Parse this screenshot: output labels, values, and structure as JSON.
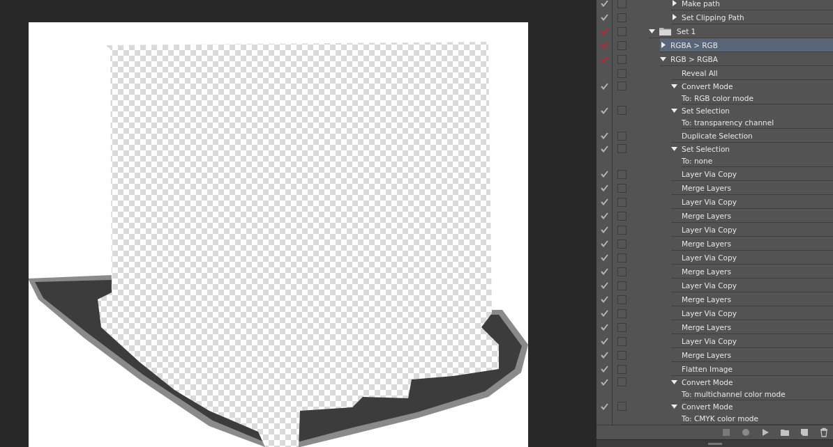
{
  "actions_panel": {
    "items": [
      {
        "kind": "command",
        "label": "Make path",
        "checked": true,
        "expanded": false,
        "selected": false
      },
      {
        "kind": "command",
        "label": "Set Clipping Path",
        "checked": true,
        "expanded": false,
        "selected": false
      },
      {
        "kind": "set",
        "label": "Set 1",
        "checked": true,
        "partial": true,
        "expanded": true,
        "selected": false,
        "children": [
          {
            "kind": "action",
            "label": "RGBA > RGB",
            "checked": true,
            "partial": true,
            "expanded": false,
            "selected": true
          },
          {
            "kind": "action",
            "label": "RGB > RGBA",
            "checked": true,
            "partial": true,
            "expanded": true,
            "selected": false,
            "children": [
              {
                "kind": "command",
                "label": "Reveal All",
                "checked": false,
                "partial": false,
                "selected": false
              },
              {
                "kind": "command",
                "label": "Convert Mode",
                "checked": true,
                "partial": false,
                "expanded": true,
                "selected": false,
                "children": [
                  {
                    "kind": "detail",
                    "label": "To: RGB color mode"
                  }
                ]
              },
              {
                "kind": "command",
                "label": "Set Selection",
                "checked": true,
                "partial": false,
                "expanded": true,
                "selected": false,
                "children": [
                  {
                    "kind": "detail",
                    "label": "To: transparency channel"
                  }
                ]
              },
              {
                "kind": "command",
                "label": "Duplicate Selection",
                "checked": true,
                "partial": false,
                "selected": false
              },
              {
                "kind": "command",
                "label": "Set Selection",
                "checked": true,
                "partial": false,
                "expanded": true,
                "selected": false,
                "children": [
                  {
                    "kind": "detail",
                    "label": "To: none"
                  }
                ]
              },
              {
                "kind": "command",
                "label": "Layer Via Copy",
                "checked": true,
                "partial": false,
                "selected": false
              },
              {
                "kind": "command",
                "label": "Merge Layers",
                "checked": true,
                "partial": false,
                "selected": false
              },
              {
                "kind": "command",
                "label": "Layer Via Copy",
                "checked": true,
                "partial": false,
                "selected": false
              },
              {
                "kind": "command",
                "label": "Merge Layers",
                "checked": true,
                "partial": false,
                "selected": false
              },
              {
                "kind": "command",
                "label": "Layer Via Copy",
                "checked": true,
                "partial": false,
                "selected": false
              },
              {
                "kind": "command",
                "label": "Merge Layers",
                "checked": true,
                "partial": false,
                "selected": false
              },
              {
                "kind": "command",
                "label": "Layer Via Copy",
                "checked": true,
                "partial": false,
                "selected": false
              },
              {
                "kind": "command",
                "label": "Merge Layers",
                "checked": true,
                "partial": false,
                "selected": false
              },
              {
                "kind": "command",
                "label": "Layer Via Copy",
                "checked": true,
                "partial": false,
                "selected": false
              },
              {
                "kind": "command",
                "label": "Merge Layers",
                "checked": true,
                "partial": false,
                "selected": false
              },
              {
                "kind": "command",
                "label": "Layer Via Copy",
                "checked": true,
                "partial": false,
                "selected": false
              },
              {
                "kind": "command",
                "label": "Merge Layers",
                "checked": true,
                "partial": false,
                "selected": false
              },
              {
                "kind": "command",
                "label": "Layer Via Copy",
                "checked": true,
                "partial": false,
                "selected": false
              },
              {
                "kind": "command",
                "label": "Merge Layers",
                "checked": true,
                "partial": false,
                "selected": false
              },
              {
                "kind": "command",
                "label": "Flatten Image",
                "checked": true,
                "partial": false,
                "selected": false
              },
              {
                "kind": "command",
                "label": "Convert Mode",
                "checked": true,
                "partial": false,
                "expanded": true,
                "selected": false,
                "children": [
                  {
                    "kind": "detail",
                    "label": "To: multichannel color mode"
                  }
                ]
              },
              {
                "kind": "command",
                "label": "Convert Mode",
                "checked": true,
                "partial": false,
                "expanded": true,
                "selected": false,
                "children": [
                  {
                    "kind": "detail",
                    "label": "To: CMYK color mode"
                  }
                ]
              }
            ]
          }
        ]
      }
    ]
  }
}
